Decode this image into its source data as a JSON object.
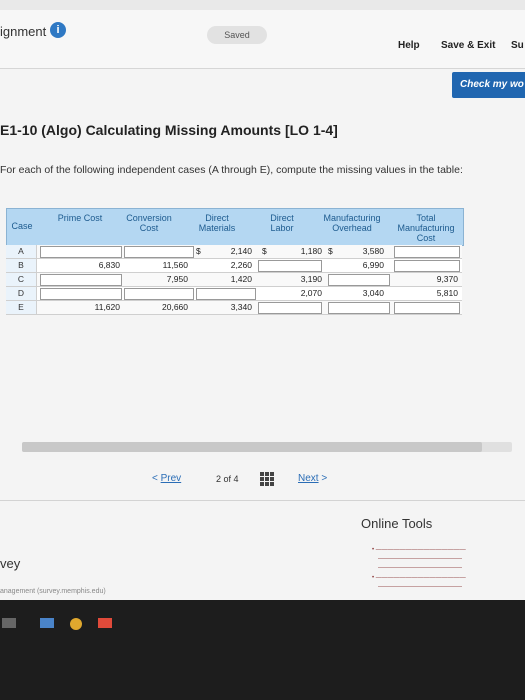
{
  "header": {
    "assignment_label": "ignment",
    "saved_label": "Saved",
    "help_label": "Help",
    "save_exit_label": "Save & Exit",
    "submit_label": "Su",
    "check_label": "Check my wo"
  },
  "question": {
    "title": "E1-10 (Algo) Calculating Missing Amounts [LO 1-4]",
    "instructions": "For each of the following independent cases (A through E), compute the missing values in the table:"
  },
  "table": {
    "headers": {
      "case": "Case",
      "prime": "Prime Cost",
      "conversion": "Conversion Cost",
      "dm": "Direct Materials",
      "dl": "Direct Labor",
      "moh": "Manufacturing Overhead",
      "tmc": "Total Manufacturing Cost"
    },
    "rows": [
      {
        "case": "A",
        "prime": "",
        "conversion": "",
        "dm": "2,140",
        "dl": "1,180",
        "moh": "3,580",
        "tmc": ""
      },
      {
        "case": "B",
        "prime": "6,830",
        "conversion": "11,560",
        "dm": "2,260",
        "dl": "",
        "moh": "6,990",
        "tmc": ""
      },
      {
        "case": "C",
        "prime": "",
        "conversion": "7,950",
        "dm": "1,420",
        "dl": "3,190",
        "moh": "",
        "tmc": "9,370"
      },
      {
        "case": "D",
        "prime": "",
        "conversion": "",
        "dm": "",
        "dl": "2,070",
        "moh": "3,040",
        "tmc": "5,810"
      },
      {
        "case": "E",
        "prime": "11,620",
        "conversion": "20,660",
        "dm": "3,340",
        "dl": "",
        "moh": "",
        "tmc": ""
      }
    ],
    "currency_symbol": "$"
  },
  "pager": {
    "prev_label": "Prev",
    "page_text": "2 of 4",
    "next_label": "Next"
  },
  "sidebar": {
    "online_tools_title": "Online Tools",
    "survey_label": "vey",
    "management_text": "anagement (survey.memphis.edu)"
  },
  "colors": {
    "header_blue": "#b4d7f2",
    "link_blue": "#2a6db6",
    "button_blue": "#2066b0"
  }
}
